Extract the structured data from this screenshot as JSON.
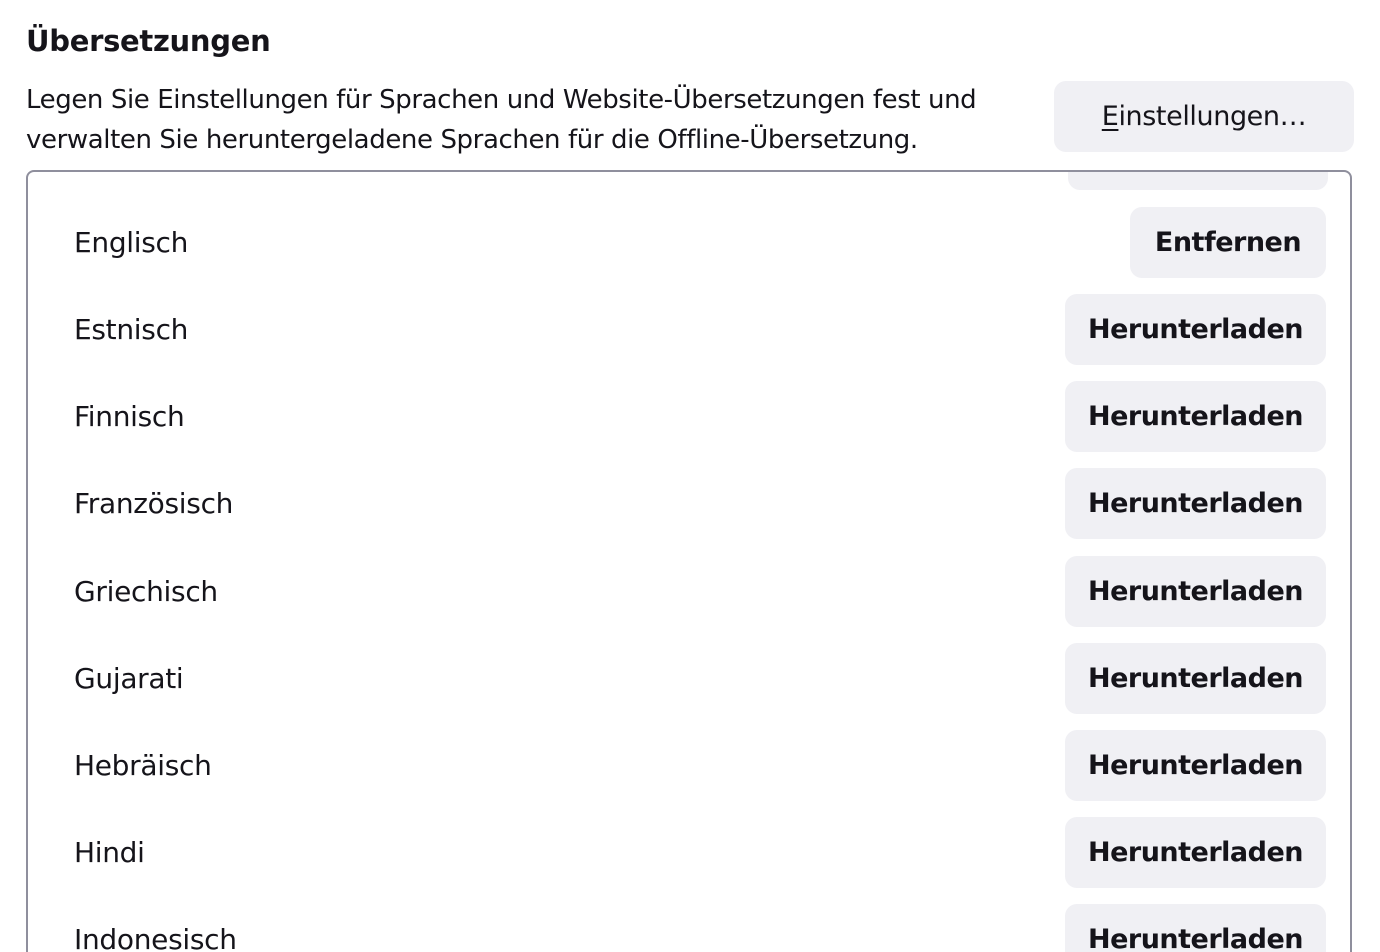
{
  "section": {
    "title": "Übersetzungen",
    "description_lines": [
      "Legen Sie Einstellungen für Sprachen und Website-Übersetzungen fest und",
      "verwalten Sie heruntergeladene Sprachen für die Offline-Übersetzung."
    ],
    "settings_button": {
      "accesskey": "E",
      "label_rest": "instellungen…"
    }
  },
  "languages": [
    {
      "name": "Englisch",
      "action": "Entfernen",
      "installed": true
    },
    {
      "name": "Estnisch",
      "action": "Herunterladen",
      "installed": false
    },
    {
      "name": "Finnisch",
      "action": "Herunterladen",
      "installed": false
    },
    {
      "name": "Französisch",
      "action": "Herunterladen",
      "installed": false
    },
    {
      "name": "Griechisch",
      "action": "Herunterladen",
      "installed": false
    },
    {
      "name": "Gujarati",
      "action": "Herunterladen",
      "installed": false
    },
    {
      "name": "Hebräisch",
      "action": "Herunterladen",
      "installed": false
    },
    {
      "name": "Hindi",
      "action": "Herunterladen",
      "installed": false
    },
    {
      "name": "Indonesisch",
      "action": "Herunterladen",
      "installed": false
    }
  ],
  "colors": {
    "button_bg": "#f0f0f4",
    "text": "#15141a",
    "border": "#8f8f9d"
  }
}
